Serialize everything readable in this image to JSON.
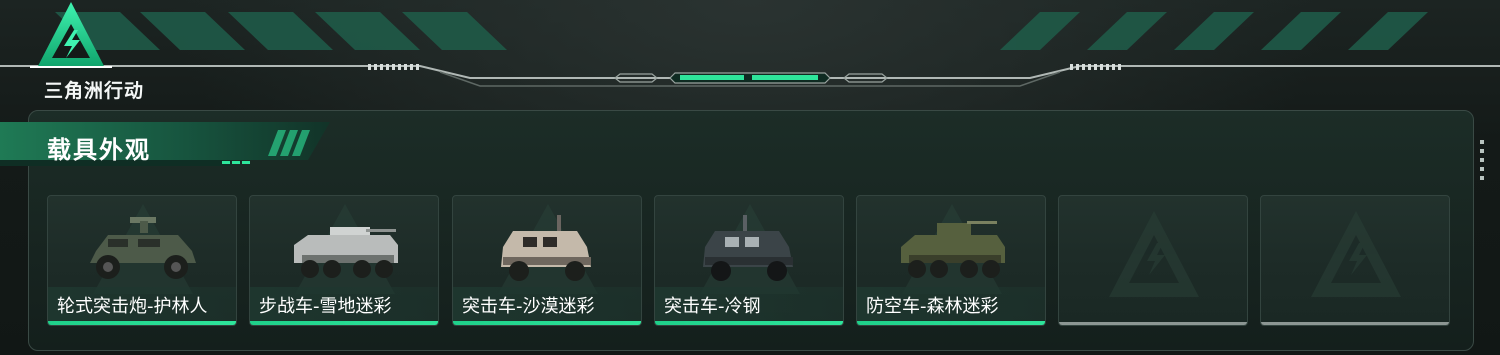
{
  "app": {
    "logo_text": "三角洲行动"
  },
  "section": {
    "title": "载具外观"
  },
  "skins": [
    {
      "name": "轮式突击炮-护林人",
      "camo": "#4d5a49",
      "state": "owned"
    },
    {
      "name": "步战车-雪地迷彩",
      "camo": "#b9bcbb",
      "state": "owned"
    },
    {
      "name": "突击车-沙漠迷彩",
      "camo": "#c4b9aa",
      "state": "owned"
    },
    {
      "name": "突击车-冷钢",
      "camo": "#3b4448",
      "state": "owned"
    },
    {
      "name": "防空车-森林迷彩",
      "camo": "#56603e",
      "state": "owned"
    },
    {
      "name": "",
      "state": "empty"
    },
    {
      "name": "",
      "state": "empty"
    }
  ],
  "colors": {
    "accent": "#2ee59b",
    "panel_border": "#3a4a45",
    "empty_underline": "#8c9693"
  }
}
